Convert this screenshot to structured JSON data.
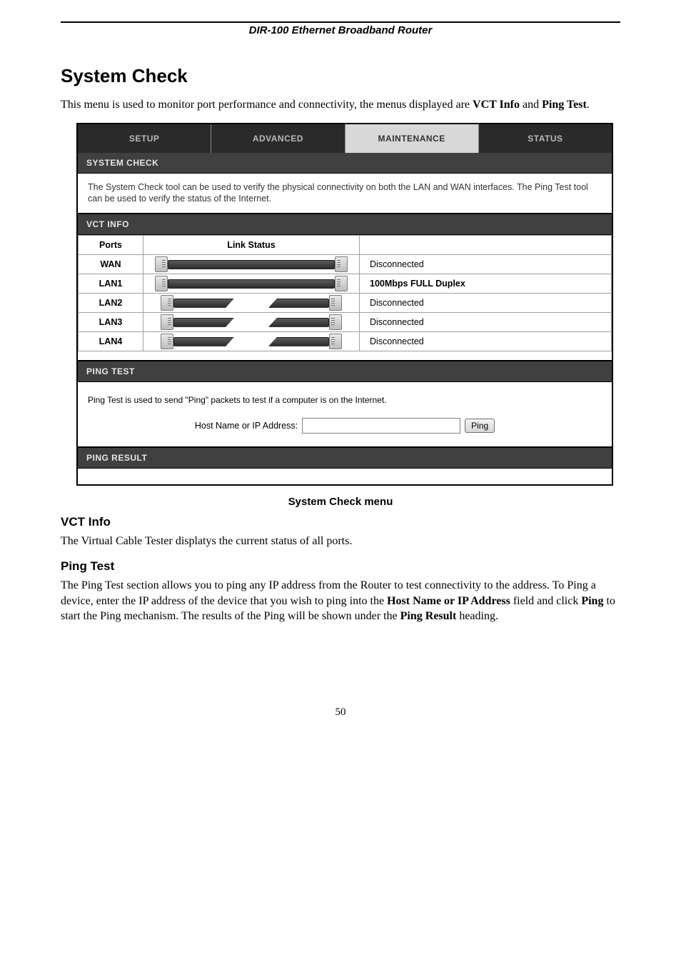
{
  "header": {
    "product": "DIR-100 Ethernet Broadband Router"
  },
  "title": "System Check",
  "intro": {
    "pre": "This menu is used to monitor port performance and connectivity, the menus displayed are ",
    "b1": "VCT Info",
    "mid": " and ",
    "b2": "Ping Test",
    "post": "."
  },
  "ui": {
    "tabs": {
      "setup": "SETUP",
      "advanced": "ADVANCED",
      "maintenance": "MAINTENANCE",
      "status": "STATUS"
    },
    "syscheck": {
      "title": "SYSTEM CHECK",
      "desc": "The System Check tool can be used to verify the physical connectivity on both the LAN and WAN interfaces. The Ping Test tool can be used to verify the status of the Internet."
    },
    "vct": {
      "title": "VCT INFO",
      "cols": {
        "ports": "Ports",
        "link": "Link Status"
      },
      "rows": [
        {
          "port": "WAN",
          "status": "Disconnected",
          "broken": false
        },
        {
          "port": "LAN1",
          "status": "100Mbps FULL Duplex",
          "broken": false
        },
        {
          "port": "LAN2",
          "status": "Disconnected",
          "broken": true
        },
        {
          "port": "LAN3",
          "status": "Disconnected",
          "broken": true
        },
        {
          "port": "LAN4",
          "status": "Disconnected",
          "broken": true
        }
      ]
    },
    "pingtest": {
      "title": "PING TEST",
      "desc": "Ping Test is used to send \"Ping\" packets to test if a computer is on the Internet.",
      "host_label": "Host Name or IP Address:",
      "host_value": "",
      "button": "Ping"
    },
    "pingresult": {
      "title": "PING RESULT"
    }
  },
  "caption": "System Check menu",
  "vct_section": {
    "title": "VCT Info",
    "body": "The Virtual Cable Tester displatys the current status of all ports."
  },
  "ping_section": {
    "title": "Ping Test",
    "p": {
      "t1": "The Ping Test section allows you to ping any IP address from the Router to test connectivity to the address. To Ping a device, enter the IP address of the device that you wish to ping into the ",
      "b1": "Host Name or IP Address",
      "t2": " field and click ",
      "b2": "Ping",
      "t3": " to start the Ping mechanism. The results of the Ping will be shown under the ",
      "b3": "Ping Result",
      "t4": " heading."
    }
  },
  "page_number": "50"
}
